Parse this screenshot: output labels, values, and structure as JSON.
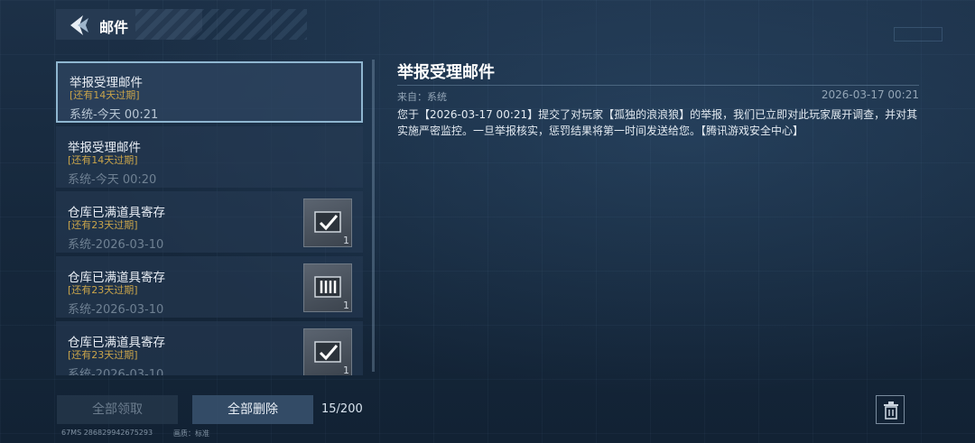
{
  "header": {
    "title": "邮件",
    "back_icon": "back-arrow-icon"
  },
  "mails": [
    {
      "subject": "举报受理邮件",
      "expire": "[还有14天过期]",
      "meta": "系统-今天 00:21",
      "attachment": null
    },
    {
      "subject": "举报受理邮件",
      "expire": "[还有14天过期]",
      "meta": "系统-今天 00:20",
      "attachment": null
    },
    {
      "subject": "仓库已满道具寄存",
      "expire": "[还有23天过期]",
      "meta": "系统-2026-03-10",
      "attachment": {
        "icon": "item-crate-icon",
        "count": "1"
      }
    },
    {
      "subject": "仓库已满道具寄存",
      "expire": "[还有23天过期]",
      "meta": "系统-2026-03-10",
      "attachment": {
        "icon": "item-crate-icon",
        "count": "1"
      }
    },
    {
      "subject": "仓库已满道具寄存",
      "expire": "[还有23天过期]",
      "meta": "系统-2026-03-10",
      "attachment": {
        "icon": "item-crate-icon",
        "count": "1"
      }
    }
  ],
  "detail": {
    "title": "举报受理邮件",
    "sender": "来自：系统",
    "time": "2026-03-17 00:21",
    "body": "您于【2026-03-17 00:21】提交了对玩家【孤独的浪浪狼】的举报，我们已立即对此玩家展开调查，并对其实施严密监控。一旦举报核实，惩罚结果将第一时间发送给您。【腾讯游戏安全中心】"
  },
  "actions": {
    "collect_all": "全部领取",
    "delete_all": "全部删除",
    "count": "15/200"
  },
  "footer": {
    "info": "67MS  286829942675293",
    "quality": "画质：标准"
  },
  "colors": {
    "expire": "#c9a44a",
    "selected_border": "#8fb6d0"
  }
}
